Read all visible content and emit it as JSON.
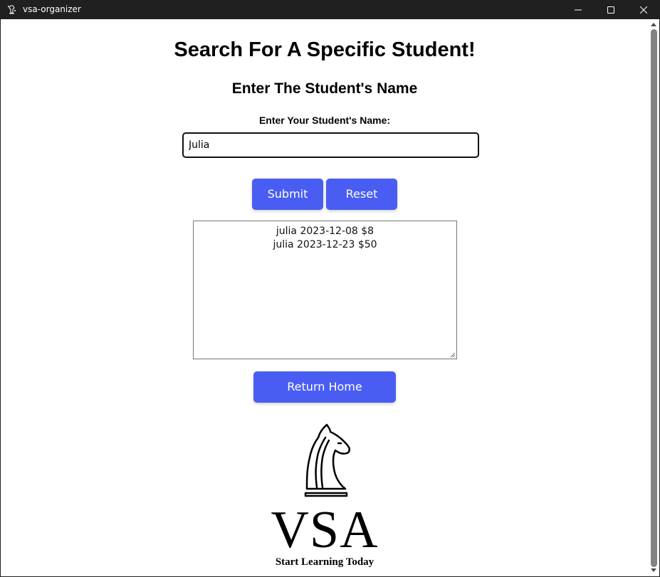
{
  "window": {
    "title": "vsa-organizer",
    "app_icon": "chess-piece-icon",
    "controls": {
      "minimize_icon": "minimize-icon",
      "maximize_icon": "maximize-icon",
      "close_icon": "close-icon"
    }
  },
  "page": {
    "title": "Search For A Specific Student!",
    "subtitle": "Enter The Student's Name",
    "field_label": "Enter Your Student's Name:",
    "name_value": "Julia",
    "submit_label": "Submit",
    "reset_label": "Reset",
    "results": [
      "julia 2023-12-08 $8",
      "julia 2023-12-23 $50"
    ],
    "home_label": "Return Home"
  },
  "logo": {
    "icon": "knight-chess-icon",
    "text": "VSA",
    "tagline": "Start Learning Today"
  },
  "colors": {
    "button": "#4a5df2",
    "titlebar": "#202020"
  }
}
